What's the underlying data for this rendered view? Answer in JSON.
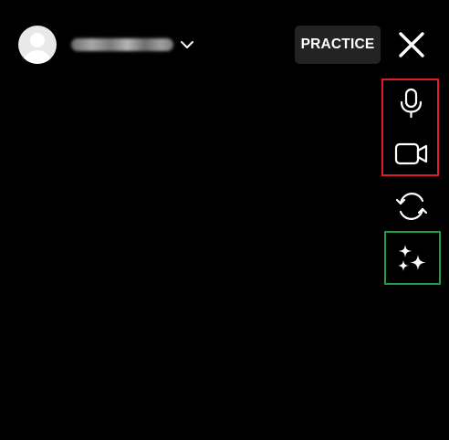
{
  "header": {
    "username": "",
    "practice_label": "PRACTICE"
  },
  "icons": {
    "avatar": "default-avatar-icon",
    "account_menu": "chevron-down-icon",
    "close": "close-icon",
    "microphone": "microphone-icon",
    "camera": "video-camera-icon",
    "flip": "flip-camera-icon",
    "effects": "sparkles-icon"
  },
  "colors": {
    "background": "#000000",
    "practice_button_bg": "#232323",
    "icon": "#ffffff",
    "highlight_red": "#e01c24",
    "highlight_green": "#1ea04a"
  }
}
